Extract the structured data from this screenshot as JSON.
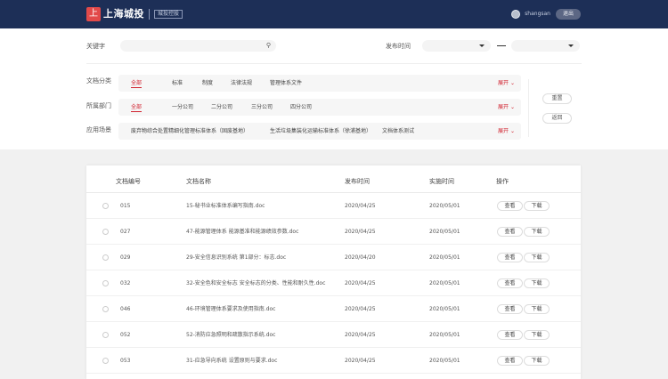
{
  "header": {
    "logo_mark": "上",
    "logo_text": "上海城投",
    "logo_sub": "城投控股",
    "username": "shangsan",
    "logout_label": "退出"
  },
  "filters": {
    "keyword_label": "关键字",
    "publish_time_label": "发布时间",
    "doc_category_label": "文档分类",
    "department_label": "所属部门",
    "scene_label": "应用场景",
    "expand_label": "展开",
    "doc_categories": [
      "全部",
      "标准",
      "制度",
      "法律法规",
      "管理体系文件"
    ],
    "departments": [
      "全部",
      "一分公司",
      "二分公司",
      "三分公司",
      "四分公司"
    ],
    "scenes": [
      "废弃物综合处置精细化管理标准体系（固废基地）",
      "生活垃圾集装化运输标准体系（徐浦基地）",
      "文档体系测试"
    ],
    "reset_label": "重置",
    "back_label": "返回"
  },
  "table": {
    "headers": [
      "文档编号",
      "文档名称",
      "发布时间",
      "实施时间",
      "操作"
    ],
    "view_label": "查看",
    "download_label": "下载",
    "rows": [
      {
        "code": "015",
        "name": "15-秘书业标准体系编写指南.doc",
        "publish": "2020/04/25",
        "implement": "2020/05/01"
      },
      {
        "code": "027",
        "name": "47-能源管理体系  能源基准和能源绩效参数.doc",
        "publish": "2020/04/25",
        "implement": "2020/05/01"
      },
      {
        "code": "029",
        "name": "29-安全信息识别系统  第1部分：标志.doc",
        "publish": "2020/04/20",
        "implement": "2020/05/01"
      },
      {
        "code": "032",
        "name": "32-安全色和安全标志  安全标志的分类、性能和耐久性.doc",
        "publish": "2020/04/25",
        "implement": "2020/05/01"
      },
      {
        "code": "046",
        "name": "46-环境管理体系要求及使用指南.doc",
        "publish": "2020/04/25",
        "implement": "2020/05/01"
      },
      {
        "code": "052",
        "name": "52-消防应急照明和疏散指示系统.doc",
        "publish": "2020/04/25",
        "implement": "2020/05/01"
      },
      {
        "code": "053",
        "name": "31-应急导向系统  设置原则与要求.doc",
        "publish": "2020/04/25",
        "implement": "2020/05/01"
      }
    ]
  }
}
